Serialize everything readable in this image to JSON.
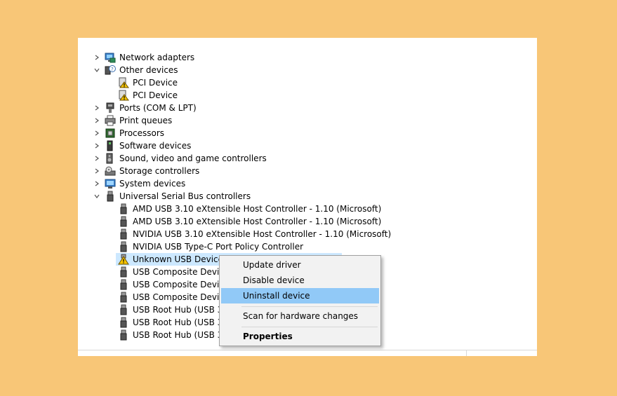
{
  "tree": {
    "items": [
      {
        "label": "Network adapters",
        "expanded": false,
        "icon": "network-adapter-icon"
      },
      {
        "label": "Other devices",
        "expanded": true,
        "icon": "unknown-device-icon"
      },
      {
        "label": "PCI Device",
        "icon": "warning-device-icon"
      },
      {
        "label": "PCI Device",
        "icon": "warning-device-icon"
      },
      {
        "label": "Ports (COM & LPT)",
        "expanded": false,
        "icon": "port-icon"
      },
      {
        "label": "Print queues",
        "expanded": false,
        "icon": "printer-icon"
      },
      {
        "label": "Processors",
        "expanded": false,
        "icon": "processor-icon"
      },
      {
        "label": "Software devices",
        "expanded": false,
        "icon": "software-device-icon"
      },
      {
        "label": "Sound, video and game controllers",
        "expanded": false,
        "icon": "speaker-icon"
      },
      {
        "label": "Storage controllers",
        "expanded": false,
        "icon": "storage-icon"
      },
      {
        "label": "System devices",
        "expanded": false,
        "icon": "system-device-icon"
      },
      {
        "label": "Universal Serial Bus controllers",
        "expanded": true,
        "icon": "usb-icon"
      },
      {
        "label": "AMD USB 3.10 eXtensible Host Controller - 1.10 (Microsoft)",
        "icon": "usb-icon"
      },
      {
        "label": "AMD USB 3.10 eXtensible Host Controller - 1.10 (Microsoft)",
        "icon": "usb-icon"
      },
      {
        "label": "NVIDIA USB 3.10 eXtensible Host Controller - 1.10 (Microsoft)",
        "icon": "usb-icon"
      },
      {
        "label": "NVIDIA USB Type-C Port Policy Controller",
        "icon": "usb-icon"
      },
      {
        "label": "Unknown USB Device (",
        "icon": "warning-usb-icon",
        "selected": true
      },
      {
        "label": "USB Composite Device",
        "icon": "usb-icon"
      },
      {
        "label": "USB Composite Device",
        "icon": "usb-icon"
      },
      {
        "label": "USB Composite Device",
        "icon": "usb-icon"
      },
      {
        "label": "USB Root Hub (USB 3.0",
        "icon": "usb-icon"
      },
      {
        "label": "USB Root Hub (USB 3.0",
        "icon": "usb-icon"
      },
      {
        "label": "USB Root Hub (USB 3.0",
        "icon": "usb-icon"
      }
    ]
  },
  "context_menu": {
    "update_driver": "Update driver",
    "disable_device": "Disable device",
    "uninstall_device": "Uninstall device",
    "scan_changes": "Scan for hardware changes",
    "properties": "Properties",
    "highlighted": "Uninstall device"
  },
  "colors": {
    "background": "#F8C677",
    "selection": "#cce8ff",
    "menu_highlight": "#91c9f7",
    "warning": "#f5c400"
  }
}
